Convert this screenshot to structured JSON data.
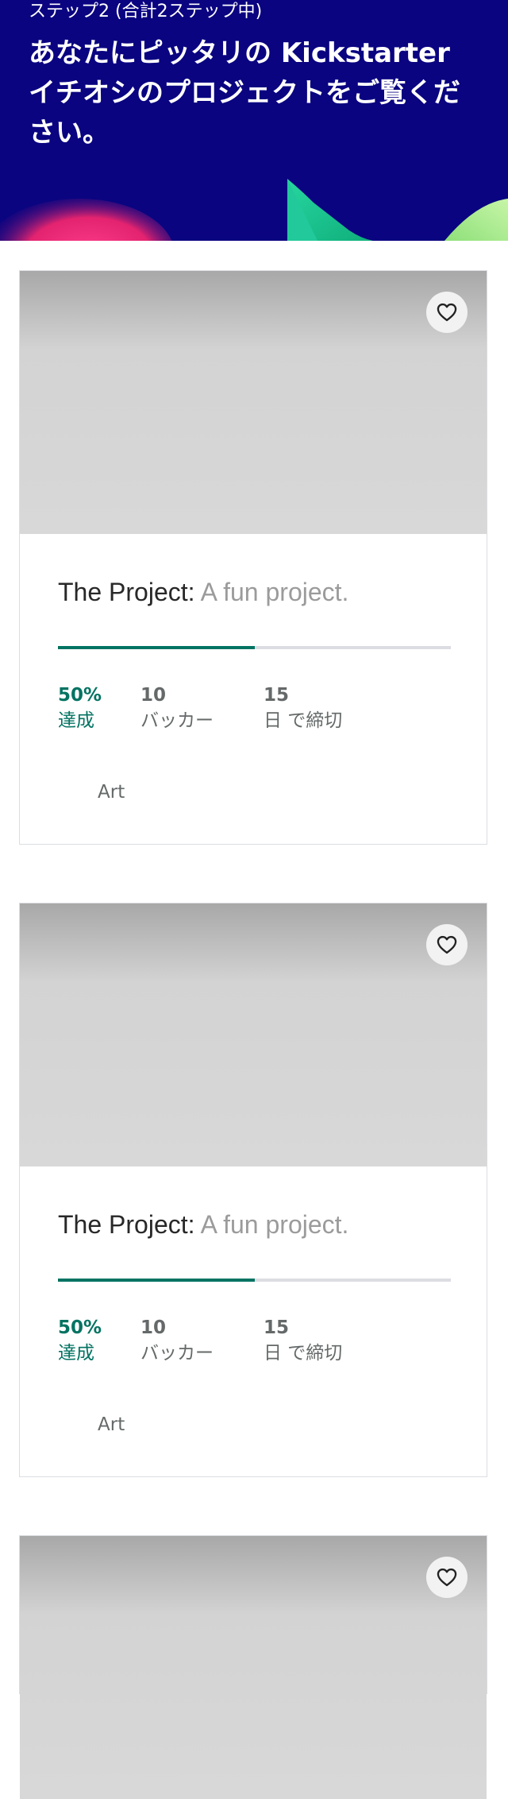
{
  "header": {
    "step_text": "ステップ2 (合計2ステップ中)",
    "headline": "あなたにピッタリの Kickstarter イチオシのプロジェクトをご覧ください。",
    "colors": {
      "background": "#0a0480",
      "text": "#ffffff"
    }
  },
  "cards": [
    {
      "favorite_icon": "heart-outline-icon",
      "name": "The Project:",
      "blurb": "A fun project.",
      "progress_fraction": 0.5,
      "funded_value": "50%",
      "funded_label": "達成",
      "backers_value": "10",
      "backers_label": "バッカー",
      "days_value": "15",
      "days_label": "日 で締切",
      "category": "Art"
    },
    {
      "favorite_icon": "heart-outline-icon",
      "name": "The Project:",
      "blurb": "A fun project.",
      "progress_fraction": 0.5,
      "funded_value": "50%",
      "funded_label": "達成",
      "backers_value": "10",
      "backers_label": "バッカー",
      "days_value": "15",
      "days_label": "日 で締切",
      "category": "Art"
    },
    {
      "favorite_icon": "heart-outline-icon"
    }
  ],
  "colors": {
    "accent_green": "#037362",
    "progress_track": "#dcdde3",
    "muted_text": "#656969",
    "blurb_text": "#9b9b9b"
  }
}
